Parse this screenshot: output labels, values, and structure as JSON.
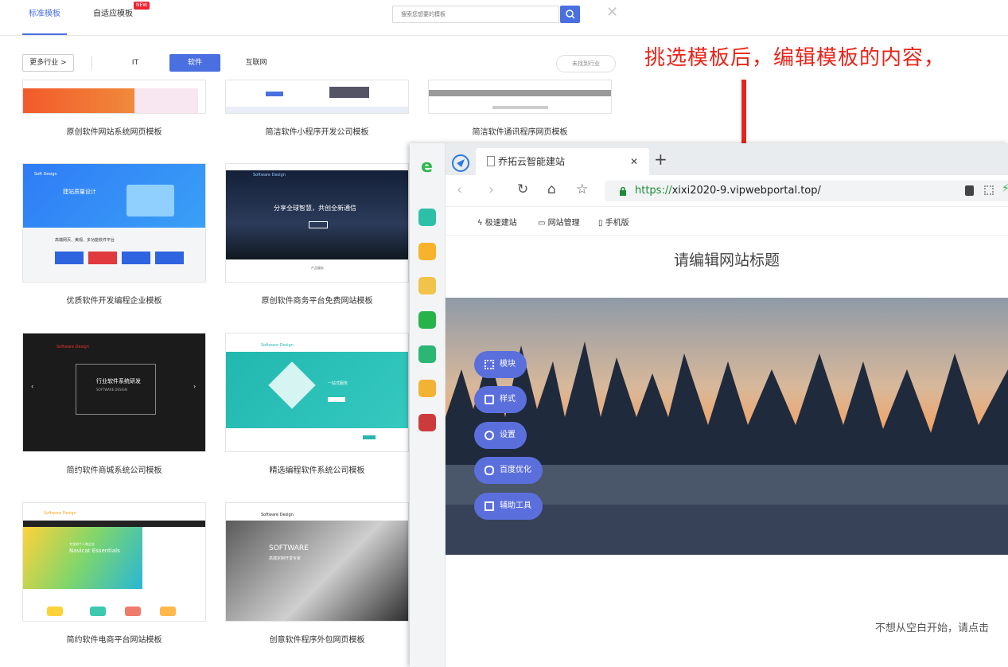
{
  "header": {
    "tab_standard": "标准模板",
    "tab_adaptive": "自适应模板",
    "new_badge": "NEW",
    "search_placeholder": "搜索您想要的模板"
  },
  "filters": {
    "more_industries": "更多行业 >",
    "items": [
      "IT",
      "软件",
      "互联网"
    ],
    "active": "软件",
    "not_found": "未找到行业"
  },
  "annotation": "挑选模板后，编辑模板的内容，",
  "templates": [
    {
      "title": "原创软件网站系统网页模板"
    },
    {
      "title": "简洁软件小程序开发公司模板"
    },
    {
      "title": "简洁软件通讯程序网页模板"
    },
    {
      "title": "优质软件开发编程企业模板",
      "thumb": {
        "brand": "Soft Design",
        "heading": "建站质量设计",
        "sub": "高端网页、美观、多功能软件平台"
      }
    },
    {
      "title": "原创软件商务平台免费网站模板",
      "thumb": {
        "brand": "Software Design",
        "heading": "分享全球智慧，共创全新通信",
        "sub": "产品服务"
      }
    },
    {
      "title": "简约软件商城系统公司模板",
      "thumb": {
        "brand": "Software Design",
        "heading": "行业软件系统研发",
        "sub": "SOFTWARE DESIGN"
      }
    },
    {
      "title": "精选编程软件系统公司模板",
      "thumb": {
        "brand": "Software Design",
        "heading": "一站式服务",
        "sub": "了解更多"
      }
    },
    {
      "title": "简约软件电商平台网站模板",
      "thumb": {
        "brand": "Software Design",
        "heading": "Navicat Essentials",
        "sub": "专业的个人和企业"
      }
    },
    {
      "title": "创意软件程序外包网页模板",
      "thumb": {
        "brand": "Software Design",
        "heading": "SOFTWARE",
        "sub": "高端定制开发专家"
      }
    }
  ],
  "browser": {
    "tab_title": "乔拓云智能建站",
    "url_scheme": "https://",
    "url_rest": "xixi2020-9.vipwebportal.top/",
    "toolbar": [
      "极速建站",
      "网站管理",
      "手机版"
    ],
    "site_title": "请编辑网站标题",
    "pills": [
      "模块",
      "样式",
      "设置",
      "百度优化",
      "辅助工具"
    ],
    "bottom_tip": "不想从空白开始，请点击"
  },
  "colors": {
    "accent": "#4a6fe0",
    "annotation": "#e8241a",
    "pill": "#5b6fdc"
  }
}
